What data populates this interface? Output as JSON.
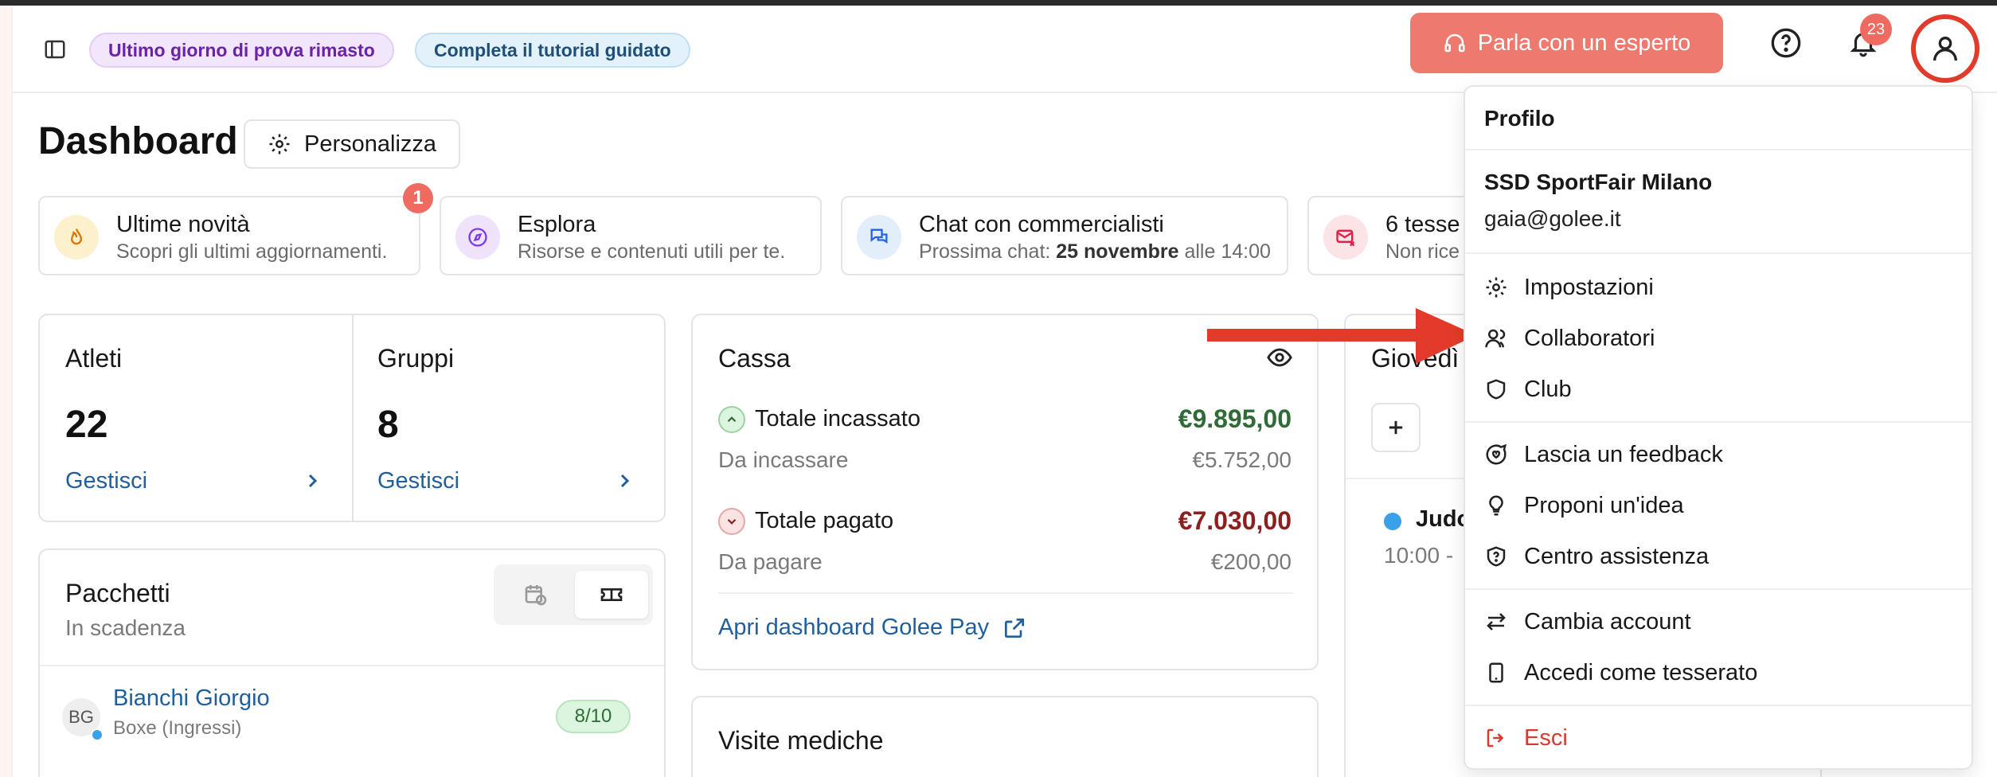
{
  "topbar": {
    "trial_pill": "Ultimo giorno di prova rimasto",
    "tutorial_pill": "Completa il tutorial guidato",
    "expert_button": "Parla con un esperto",
    "notifications_count": "23"
  },
  "page": {
    "title": "Dashboard",
    "customize_button": "Personalizza"
  },
  "info_cards": [
    {
      "title": "Ultime novità",
      "subtitle": "Scopri gli ultimi aggiornamenti.",
      "badge": "1"
    },
    {
      "title": "Esplora",
      "subtitle": "Risorse e contenuti utili per te."
    },
    {
      "title": "Chat con commercialisti",
      "subtitle_prefix": "Prossima chat: ",
      "subtitle_bold": "25 novembre",
      "subtitle_suffix": " alle 14:00"
    },
    {
      "title": "6 tesse",
      "subtitle": "Non rice"
    }
  ],
  "stats": {
    "athletes": {
      "title": "Atleti",
      "value": "22",
      "link": "Gestisci"
    },
    "groups": {
      "title": "Gruppi",
      "value": "8",
      "link": "Gestisci"
    }
  },
  "cassa": {
    "title": "Cassa",
    "total_collected_label": "Totale incassato",
    "total_collected": "€9.895,00",
    "to_collect_label": "Da incassare",
    "to_collect": "€5.752,00",
    "total_paid_label": "Totale pagato",
    "total_paid": "€7.030,00",
    "to_pay_label": "Da pagare",
    "to_pay": "€200,00",
    "link": "Apri dashboard Golee Pay"
  },
  "packages": {
    "title": "Pacchetti",
    "subtitle": "In scadenza",
    "row": {
      "initials": "BG",
      "name": "Bianchi Giorgio",
      "detail": "Boxe (Ingressi)",
      "count": "8/10"
    }
  },
  "medical": {
    "title": "Visite mediche"
  },
  "calendar": {
    "title": "Giovedì",
    "event_name": "Judo",
    "event_time": "10:00 -"
  },
  "profile_menu": {
    "header": "Profilo",
    "org_name": "SSD SportFair Milano",
    "email": "gaia@golee.it",
    "items": {
      "settings": "Impostazioni",
      "collaborators": "Collaboratori",
      "club": "Club",
      "feedback": "Lascia un feedback",
      "idea": "Proponi un'idea",
      "help": "Centro assistenza",
      "switch": "Cambia account",
      "member": "Accedi come tesserato",
      "logout": "Esci"
    }
  },
  "colors": {
    "accent_red": "#e23b2b",
    "expert_button": "#ee7a6f",
    "link_blue": "#1f5f9e",
    "positive_green": "#2e6b36",
    "negative_red": "#8e1f1f"
  }
}
